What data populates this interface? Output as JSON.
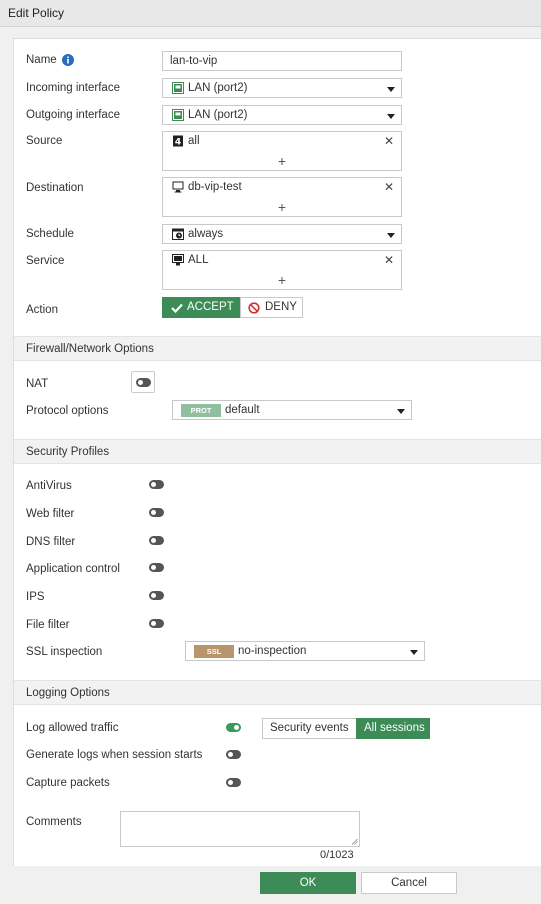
{
  "window": {
    "title": "Edit Policy"
  },
  "form": {
    "name": {
      "label": "Name",
      "value": "lan-to-vip"
    },
    "incoming": {
      "label": "Incoming interface",
      "value": "LAN (port2)",
      "icon": "lan-port-icon"
    },
    "outgoing": {
      "label": "Outgoing interface",
      "value": "LAN (port2)",
      "icon": "lan-port-icon"
    },
    "source": {
      "label": "Source",
      "value": "all",
      "icon": "address-group-icon"
    },
    "destination": {
      "label": "Destination",
      "value": "db-vip-test",
      "icon": "virtual-ip-icon"
    },
    "schedule": {
      "label": "Schedule",
      "value": "always",
      "icon": "schedule-icon"
    },
    "service": {
      "label": "Service",
      "value": "ALL",
      "icon": "service-icon"
    },
    "action": {
      "label": "Action",
      "accept": "ACCEPT",
      "deny": "DENY",
      "selected": "ACCEPT"
    }
  },
  "firewall": {
    "title": "Firewall/Network Options",
    "nat_label": "NAT",
    "nat_enabled": false,
    "protocol_label": "Protocol options",
    "protocol_badge": "PROT",
    "protocol_value": "default"
  },
  "security": {
    "title": "Security Profiles",
    "items": [
      {
        "label": "AntiVirus",
        "enabled": false
      },
      {
        "label": "Web filter",
        "enabled": false
      },
      {
        "label": "DNS filter",
        "enabled": false
      },
      {
        "label": "Application control",
        "enabled": false
      },
      {
        "label": "IPS",
        "enabled": false
      },
      {
        "label": "File filter",
        "enabled": false
      }
    ],
    "ssl_label": "SSL inspection",
    "ssl_badge": "SSL",
    "ssl_value": "no-inspection"
  },
  "logging": {
    "title": "Logging Options",
    "log_allowed_label": "Log allowed traffic",
    "log_allowed_enabled": true,
    "security_events": "Security events",
    "all_sessions": "All sessions",
    "gen_logs_label": "Generate logs when session starts",
    "gen_logs_enabled": false,
    "capture_label": "Capture packets",
    "capture_enabled": false
  },
  "comments": {
    "label": "Comments",
    "value": "",
    "counter": "0/1023"
  },
  "footer": {
    "ok": "OK",
    "cancel": "Cancel"
  },
  "colors": {
    "accent": "#3d8b57",
    "toggle_off": "#555555",
    "prot_badge": "#8fbf9f",
    "ssl_badge": "#b8956a"
  }
}
